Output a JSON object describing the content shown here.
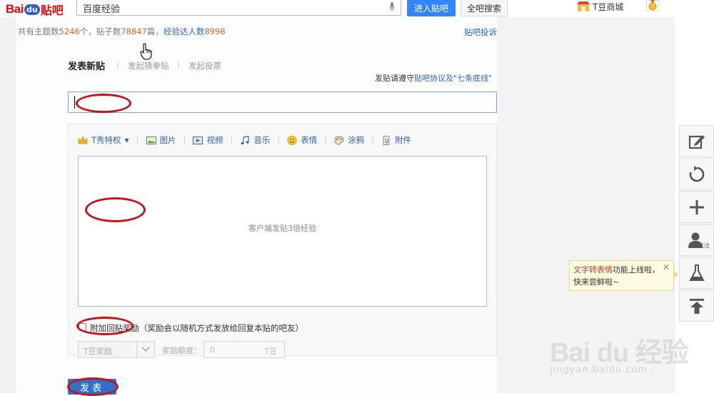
{
  "header": {
    "logo_bai": "Bai",
    "logo_du": "du",
    "logo_tieba": "贴吧",
    "search_value": "百度经验",
    "enter_button": "进入贴吧",
    "search_all_button": "全吧搜索",
    "mall_label": "T豆商城"
  },
  "stats": {
    "topics_label": "共有主题数",
    "topics": "5246",
    "topics_unit": "个，贴子数",
    "posts": "78847",
    "posts_unit": "篇，",
    "experts_label": "经验达人数",
    "experts": "8998"
  },
  "report_link": "贴吧投诉",
  "tabs": {
    "new_post": "发表新贴",
    "ringtone": "发起猜拳贴",
    "vote": "发起投票",
    "separator": "|"
  },
  "rules": {
    "prefix": "发贴请遵守",
    "link": "贴吧协议及\"七条底线\""
  },
  "toolbar": {
    "tshow": "T秀特权",
    "image": "图片",
    "video": "视频",
    "music": "音乐",
    "emoji": "表情",
    "doodle": "涂鸦",
    "attachment": "附件",
    "separator": "|"
  },
  "editor": {
    "placeholder": "客户端发贴3倍经验"
  },
  "reward": {
    "label": "附加回贴奖励",
    "note": "（奖励会以随机方式发放给回复本贴的吧友）",
    "select_value": "T豆奖励",
    "amount_label": "奖励额度：",
    "amount_value": "0",
    "amount_unit": "T豆"
  },
  "submit_label": "发表",
  "sidebar": {
    "follow_tag": "关注"
  },
  "tooltip": {
    "highlight": "文字转表情",
    "text1": "功能上线啦，",
    "text2": "快来尝鲜啦~",
    "close": "✕"
  },
  "watermark": {
    "brand": "Bai du 经验",
    "url": "jingyan.baidu.com"
  },
  "colors": {
    "brand_red": "#e10601",
    "link_blue": "#2d64b3",
    "button_blue": "#3385ff",
    "annotation_red": "#c8121a"
  }
}
